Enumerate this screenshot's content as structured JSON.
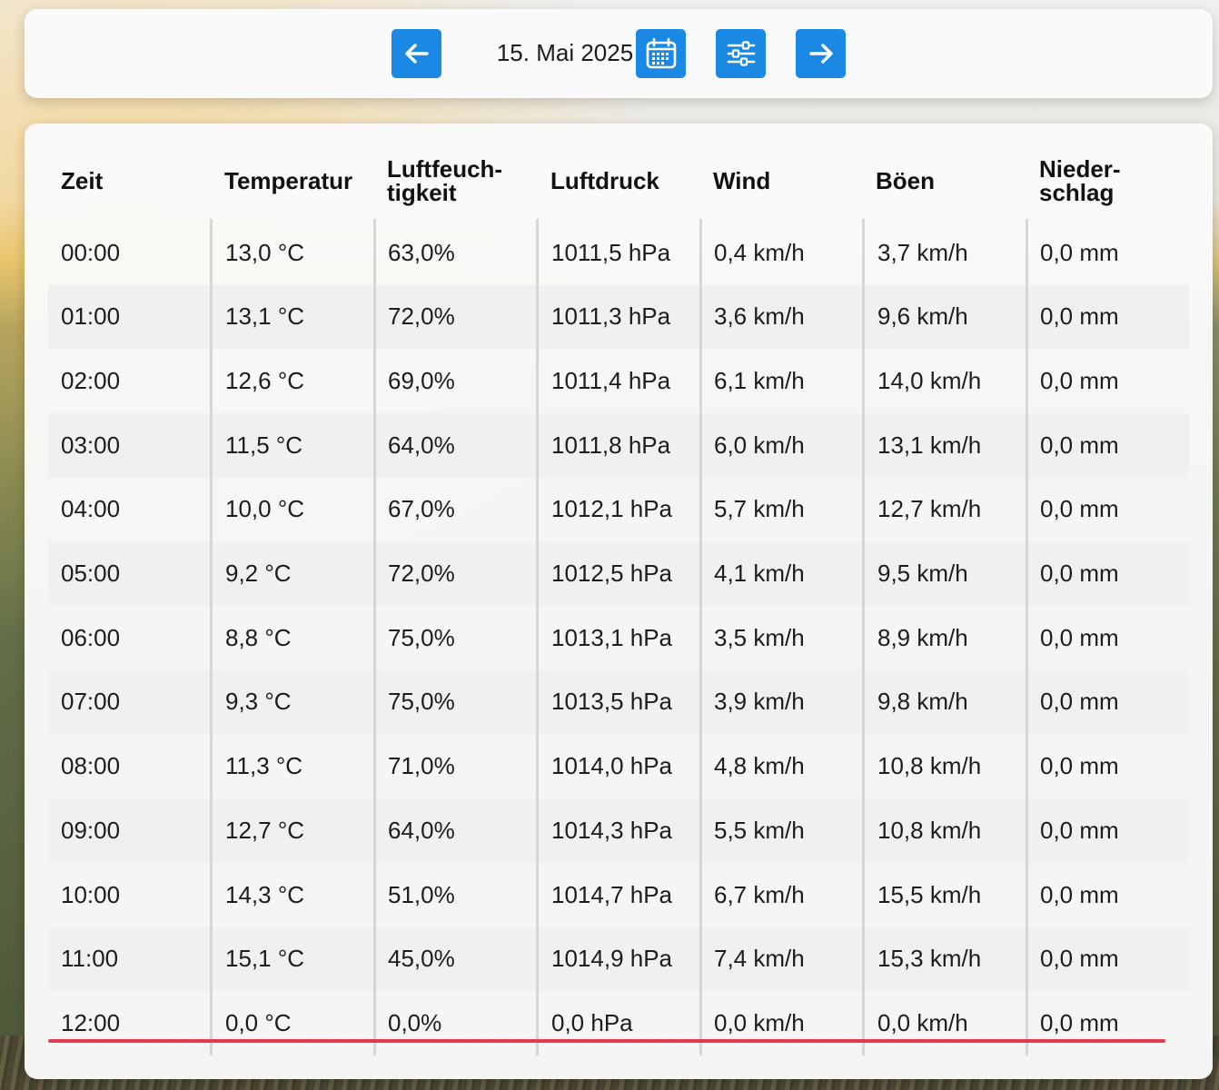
{
  "toolbar": {
    "date": "15. Mai 2025",
    "prev_icon": "arrow-left-icon",
    "calendar_icon": "calendar-icon",
    "filter_icon": "sliders-icon",
    "next_icon": "arrow-right-icon",
    "accent_color": "#1b88e3"
  },
  "table": {
    "headers": {
      "zeit": "Zeit",
      "temperatur": "Temperatur",
      "luftfeuchtigkeit_1": "Luftfeuch-",
      "luftfeuchtigkeit_2": "tigkeit",
      "luftdruck": "Luftdruck",
      "wind": "Wind",
      "boeen": "Böen",
      "niederschlag_1": "Nieder-",
      "niederschlag_2": "schlag"
    },
    "rows": [
      {
        "zeit": "00:00",
        "temp": "13,0 °C",
        "hum": "63,0%",
        "press": "1011,5 hPa",
        "wind": "0,4 km/h",
        "gust": "3,7 km/h",
        "rain": "0,0 mm"
      },
      {
        "zeit": "01:00",
        "temp": "13,1 °C",
        "hum": "72,0%",
        "press": "1011,3 hPa",
        "wind": "3,6 km/h",
        "gust": "9,6 km/h",
        "rain": "0,0 mm"
      },
      {
        "zeit": "02:00",
        "temp": "12,6 °C",
        "hum": "69,0%",
        "press": "1011,4 hPa",
        "wind": "6,1 km/h",
        "gust": "14,0 km/h",
        "rain": "0,0 mm"
      },
      {
        "zeit": "03:00",
        "temp": "11,5 °C",
        "hum": "64,0%",
        "press": "1011,8 hPa",
        "wind": "6,0 km/h",
        "gust": "13,1 km/h",
        "rain": "0,0 mm"
      },
      {
        "zeit": "04:00",
        "temp": "10,0 °C",
        "hum": "67,0%",
        "press": "1012,1 hPa",
        "wind": "5,7 km/h",
        "gust": "12,7 km/h",
        "rain": "0,0 mm"
      },
      {
        "zeit": "05:00",
        "temp": "9,2 °C",
        "hum": "72,0%",
        "press": "1012,5 hPa",
        "wind": "4,1 km/h",
        "gust": "9,5 km/h",
        "rain": "0,0 mm"
      },
      {
        "zeit": "06:00",
        "temp": "8,8 °C",
        "hum": "75,0%",
        "press": "1013,1 hPa",
        "wind": "3,5 km/h",
        "gust": "8,9 km/h",
        "rain": "0,0 mm"
      },
      {
        "zeit": "07:00",
        "temp": "9,3 °C",
        "hum": "75,0%",
        "press": "1013,5 hPa",
        "wind": "3,9 km/h",
        "gust": "9,8 km/h",
        "rain": "0,0 mm"
      },
      {
        "zeit": "08:00",
        "temp": "11,3 °C",
        "hum": "71,0%",
        "press": "1014,0 hPa",
        "wind": "4,8 km/h",
        "gust": "10,8 km/h",
        "rain": "0,0 mm"
      },
      {
        "zeit": "09:00",
        "temp": "12,7 °C",
        "hum": "64,0%",
        "press": "1014,3 hPa",
        "wind": "5,5 km/h",
        "gust": "10,8 km/h",
        "rain": "0,0 mm"
      },
      {
        "zeit": "10:00",
        "temp": "14,3 °C",
        "hum": "51,0%",
        "press": "1014,7 hPa",
        "wind": "6,7 km/h",
        "gust": "15,5 km/h",
        "rain": "0,0 mm"
      },
      {
        "zeit": "11:00",
        "temp": "15,1 °C",
        "hum": "45,0%",
        "press": "1014,9 hPa",
        "wind": "7,4 km/h",
        "gust": "15,3 km/h",
        "rain": "0,0 mm"
      },
      {
        "zeit": "12:00",
        "temp": "0,0 °C",
        "hum": "0,0%",
        "press": "0,0 hPa",
        "wind": "0,0 km/h",
        "gust": "0,0 km/h",
        "rain": "0,0 mm"
      }
    ],
    "current_row_marker_color": "#e23b4f"
  }
}
